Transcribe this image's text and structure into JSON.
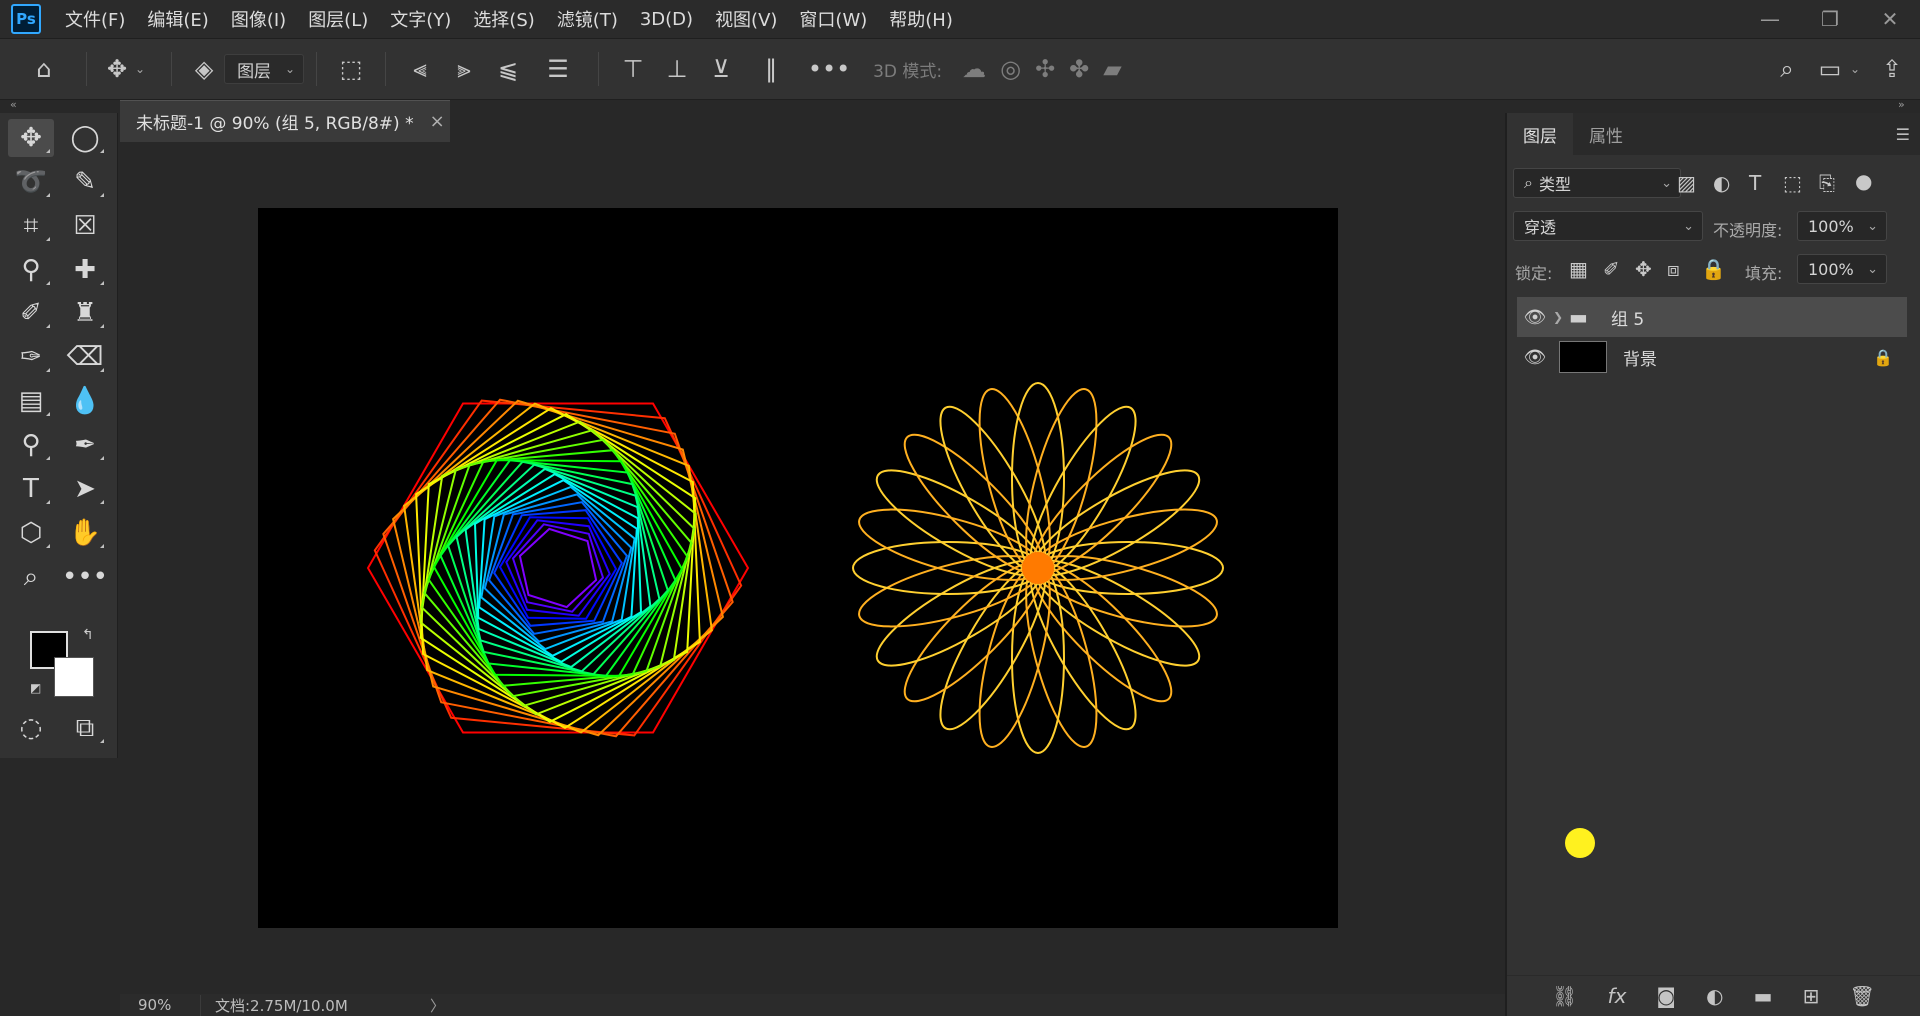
{
  "app": {
    "logo_text": "Ps"
  },
  "menu": [
    "文件(F)",
    "编辑(E)",
    "图像(I)",
    "图层(L)",
    "文字(Y)",
    "选择(S)",
    "滤镜(T)",
    "3D(D)",
    "视图(V)",
    "窗口(W)",
    "帮助(H)"
  ],
  "window_controls": {
    "minimize": "—",
    "restore": "❐",
    "close": "✕"
  },
  "options_bar": {
    "layer_select_value": "图层",
    "mode_3d_label": "3D 模式:"
  },
  "document": {
    "tab_title": "未标题-1 @ 90% (组 5, RGB/8#) *",
    "tab_close": "×"
  },
  "status": {
    "zoom": "90%",
    "doc_info": "文档:2.75M/10.0M",
    "arrow": "〉"
  },
  "colors": {
    "foreground": "#000000",
    "background": "#ffffff",
    "accent": "#31a8ff"
  },
  "panel": {
    "tabs": [
      "图层",
      "属性"
    ],
    "filter_label": "类型",
    "blend_mode": "穿透",
    "opacity_label": "不透明度:",
    "opacity_value": "100%",
    "lock_label": "锁定:",
    "fill_label": "填充:",
    "fill_value": "100%",
    "layers": [
      {
        "name": "组 5",
        "type": "group",
        "visible": true,
        "selected": true
      },
      {
        "name": "背景",
        "type": "background",
        "visible": true,
        "locked": true
      }
    ]
  }
}
